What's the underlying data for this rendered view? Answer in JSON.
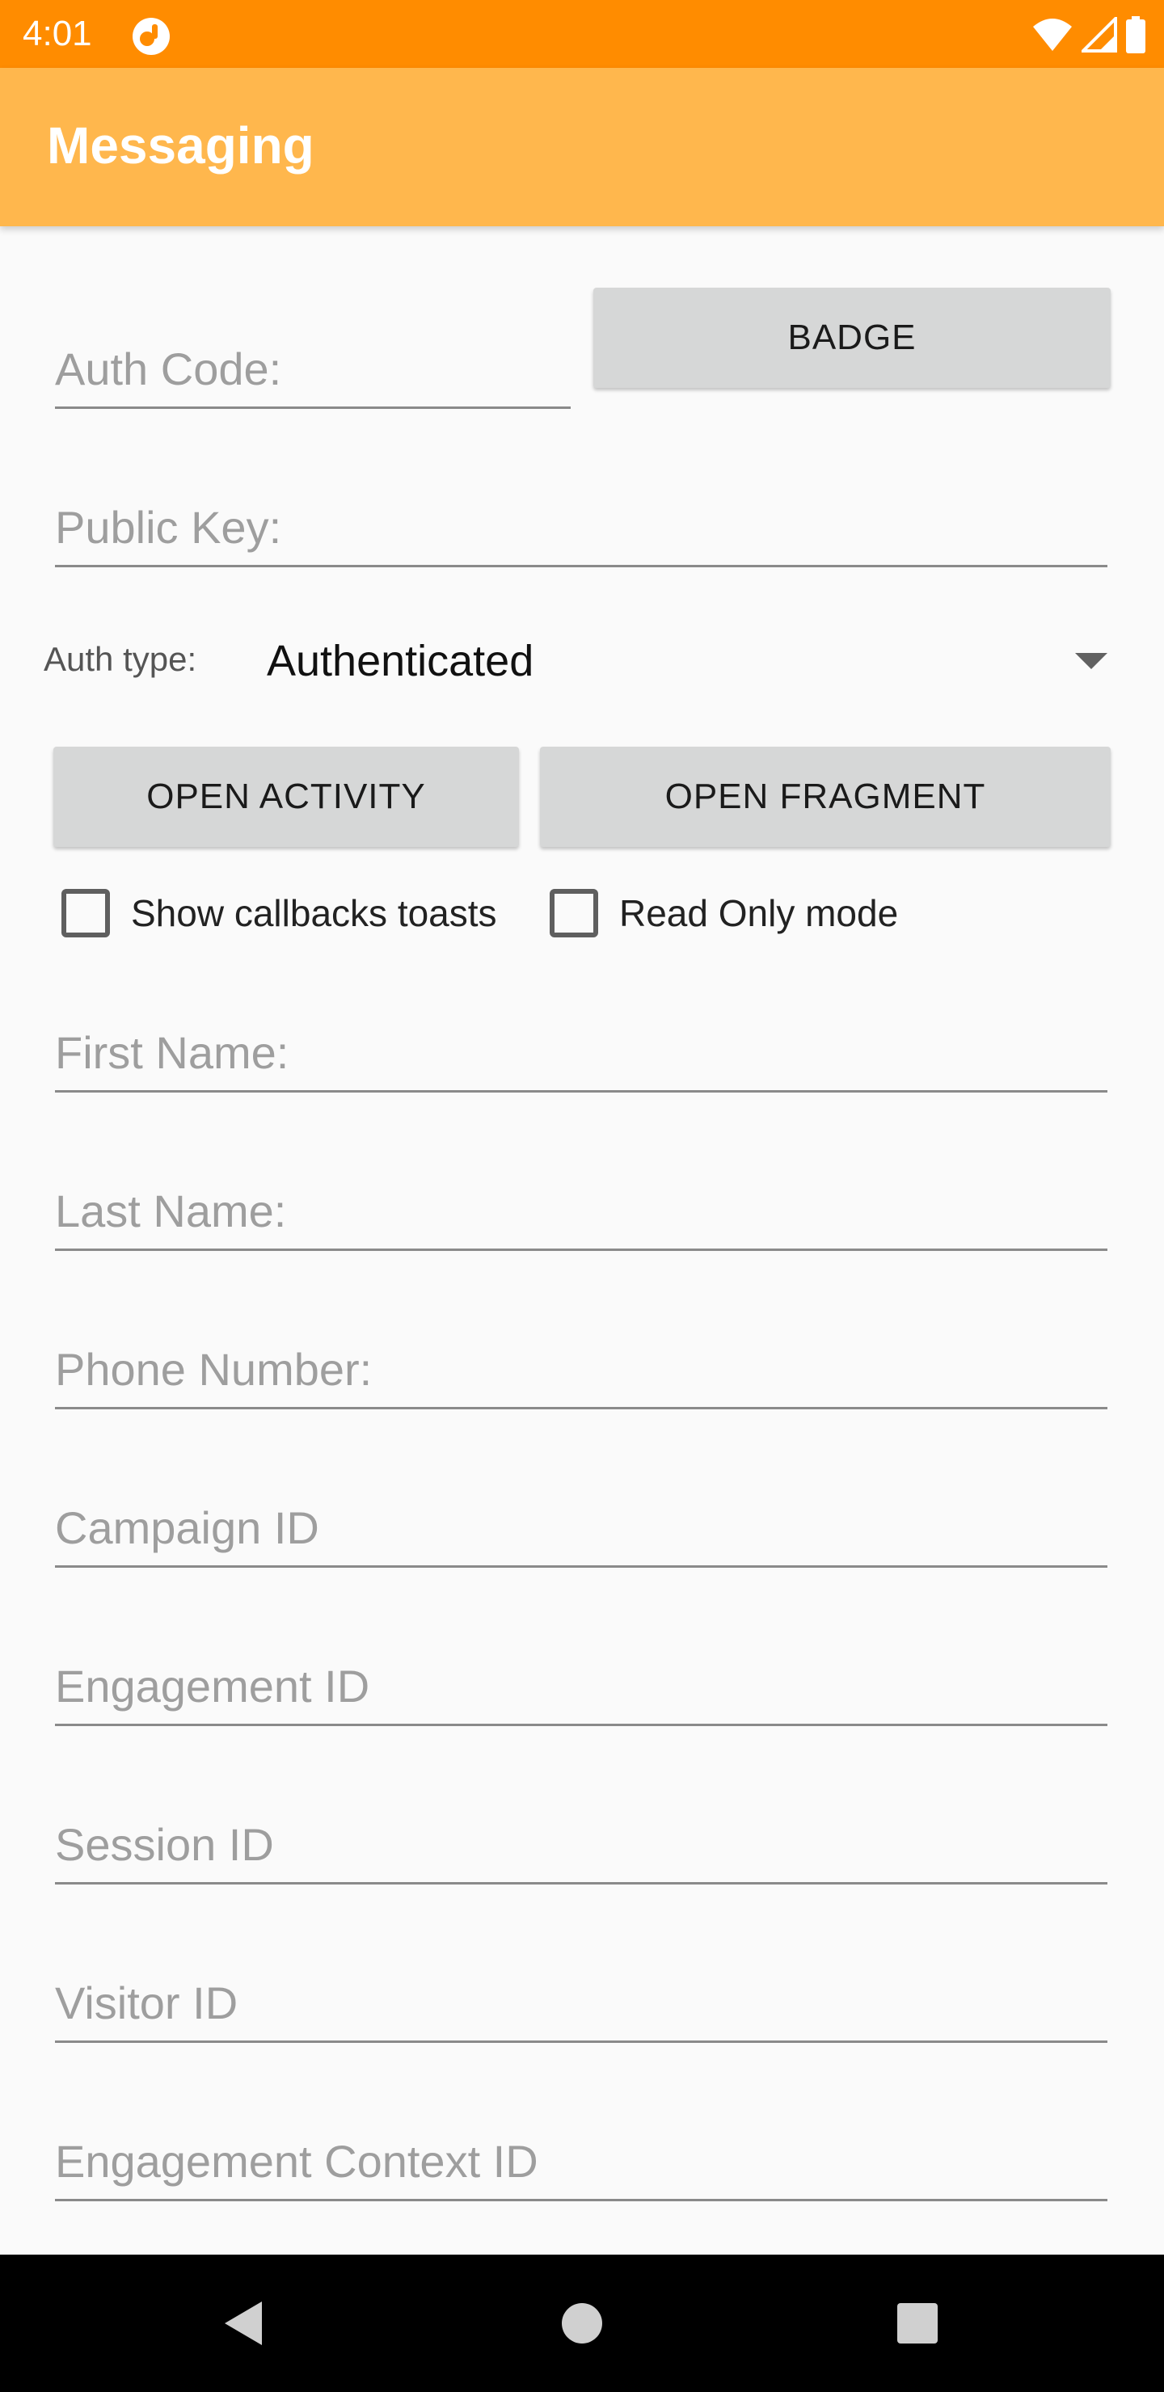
{
  "status_bar": {
    "time": "4:01",
    "app_icon": "notification-app-icon",
    "wifi_icon": "wifi-icon",
    "signal_icon": "signal-icon",
    "battery_icon": "battery-icon",
    "color": "#ff8c00"
  },
  "app_bar": {
    "title": "Messaging",
    "color": "#ffb74d"
  },
  "fields": {
    "auth_code": {
      "placeholder": "Auth Code:",
      "value": ""
    },
    "public_key": {
      "placeholder": "Public Key:",
      "value": ""
    },
    "first_name": {
      "placeholder": "First Name:",
      "value": ""
    },
    "last_name": {
      "placeholder": "Last Name:",
      "value": ""
    },
    "phone_number": {
      "placeholder": "Phone Number:",
      "value": ""
    },
    "campaign_id": {
      "placeholder": "Campaign ID",
      "value": ""
    },
    "engagement_id": {
      "placeholder": "Engagement ID",
      "value": ""
    },
    "session_id": {
      "placeholder": "Session ID",
      "value": ""
    },
    "visitor_id": {
      "placeholder": "Visitor ID",
      "value": ""
    },
    "engagement_context_id": {
      "placeholder": "Engagement Context ID",
      "value": ""
    }
  },
  "buttons": {
    "badge": "BADGE",
    "open_activity": "OPEN ACTIVITY",
    "open_fragment": "OPEN FRAGMENT"
  },
  "auth_type": {
    "label": "Auth type:",
    "selected": "Authenticated"
  },
  "checkboxes": {
    "show_callbacks_toasts": {
      "label": "Show callbacks toasts",
      "checked": false
    },
    "read_only_mode": {
      "label": "Read Only mode",
      "checked": false
    }
  },
  "nav_bar": {
    "back_icon": "back-triangle-icon",
    "home_icon": "home-circle-icon",
    "recents_icon": "recents-square-icon"
  }
}
